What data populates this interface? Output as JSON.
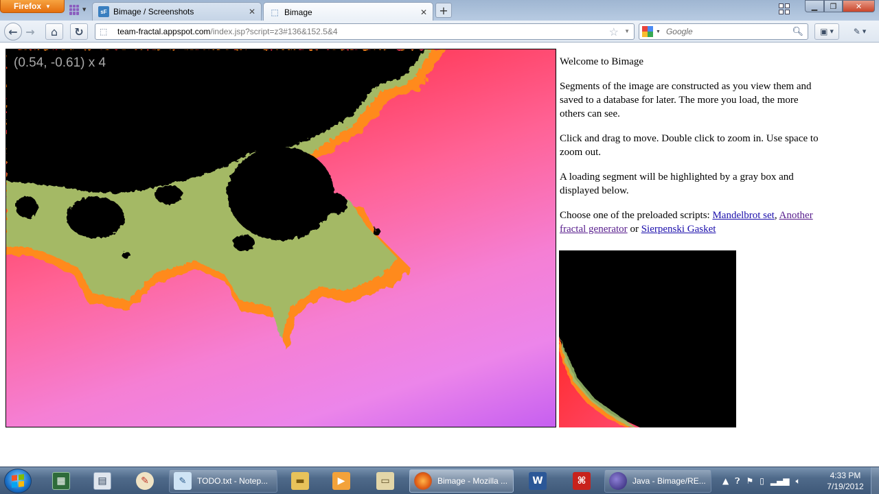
{
  "browser": {
    "app_button": "Firefox",
    "tabs": [
      {
        "label": "Bimage / Screenshots",
        "favicon": "sf-icon",
        "active": false
      },
      {
        "label": "Bimage",
        "favicon": "page-icon",
        "active": true
      }
    ],
    "url_domain": "team-fractal.appspot.com",
    "url_path": "/index.jsp?script=z3#136&152.5&4",
    "search_placeholder": "Google"
  },
  "page": {
    "coord_label": "(0.54, -0.61) x 4",
    "welcome": "Welcome to Bimage",
    "para1": "Segments of the image are constructed as you view them and saved to a database for later. The more you load, the more others can see.",
    "para2": "Click and drag to move. Double click to zoom in. Use space to zoom out.",
    "para3": "A loading segment will be highlighted by a gray box and displayed below.",
    "scripts_prefix": "Choose one of the preloaded scripts: ",
    "link_mandelbrot": "Mandelbrot set",
    "sep_comma": ", ",
    "link_another": "Another fractal generator",
    "sep_or": " or ",
    "link_sierpinski": "Sierpenski Gasket",
    "colors": {
      "fractal_set": "#000000",
      "edge_red": "#ff1e2e",
      "edge_pink": "#ff6295",
      "edge_violet": "#c65ff0",
      "edge_orange": "#ff8a1e",
      "edge_green": "#7fbf7f"
    }
  },
  "taskbar": {
    "tasks": [
      {
        "label": "TODO.txt - Notep..."
      },
      {
        "label": "Bimage - Mozilla ..."
      },
      {
        "label": "Java - Bimage/RE..."
      }
    ],
    "clock_time": "4:33 PM",
    "clock_date": "7/19/2012"
  }
}
